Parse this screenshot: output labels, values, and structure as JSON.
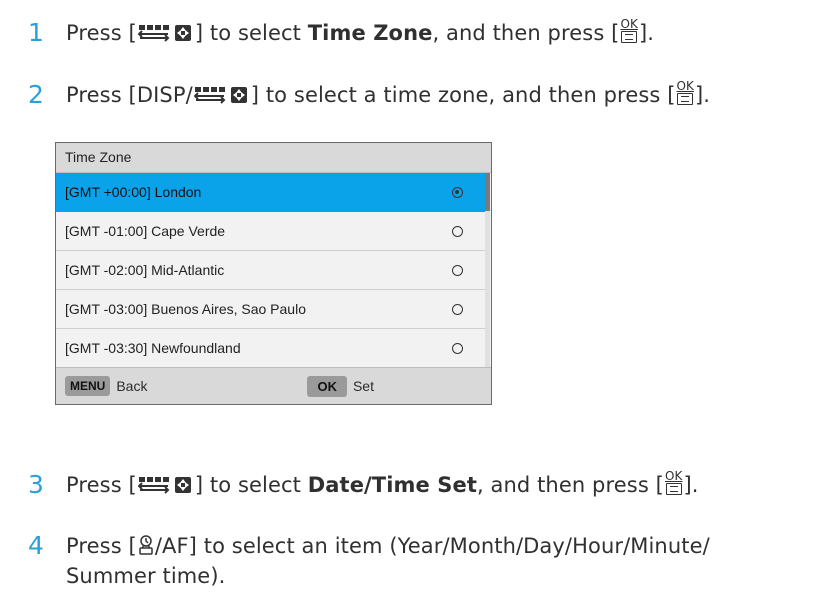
{
  "steps": [
    {
      "num": "1",
      "pre": "Press [",
      "icon": "dial-icon",
      "mid": "] to select ",
      "bold": "Time Zone",
      "post": ", and then press [",
      "end": "]."
    },
    {
      "num": "2",
      "pre": "Press [DISP/",
      "icon": "dial-icon",
      "mid": "] to select a time zone, and then press [",
      "end": "]."
    },
    {
      "num": "3",
      "pre": "Press [",
      "icon": "dial-icon",
      "mid": "] to select ",
      "bold": "Date/Time Set",
      "post": ", and then press [",
      "end": "]."
    },
    {
      "num": "4",
      "pre": "Press [",
      "icon": "timer-icon",
      "mid": "/AF] to select an item (Year/Month/Day/Hour/Minute/",
      "line2": "Summer time)."
    }
  ],
  "ok_label": "OK",
  "screen": {
    "title": "Time Zone",
    "rows": [
      {
        "label": "[GMT +00:00] London",
        "selected": true
      },
      {
        "label": "[GMT -01:00] Cape Verde",
        "selected": false
      },
      {
        "label": "[GMT -02:00] Mid-Atlantic",
        "selected": false
      },
      {
        "label": "[GMT -03:00] Buenos Aires, Sao Paulo",
        "selected": false
      },
      {
        "label": "[GMT -03:30] Newfoundland",
        "selected": false
      }
    ],
    "footer": {
      "menu_key": "MENU",
      "menu_label": "Back",
      "ok_key": "OK",
      "ok_label": "Set"
    }
  },
  "colors": {
    "accent": "#2aa0d6",
    "selection": "#0aa2e8"
  }
}
